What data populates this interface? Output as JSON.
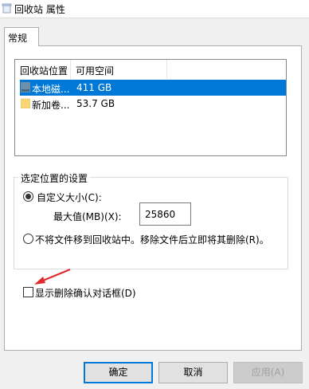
{
  "window": {
    "title": "回收站 属性"
  },
  "tabs": [
    {
      "label": "常规"
    }
  ],
  "listview": {
    "columns": [
      "回收站位置",
      "可用空间"
    ],
    "rows": [
      {
        "name": "本地磁...",
        "space": "411 GB",
        "selected": true,
        "icon": "local-disk-icon"
      },
      {
        "name": "新加卷...",
        "space": "53.7 GB",
        "selected": false,
        "icon": "folder-drive-icon"
      }
    ]
  },
  "settings": {
    "group_title": "选定位置的设置",
    "custom_size_label": "自定义大小(C):",
    "max_value_label": "最大值(MB)(X):",
    "max_value": "25860",
    "no_recycle_label": "不将文件移到回收站中。移除文件后立即将其删除(R)。"
  },
  "confirm_checkbox_label": "显示删除确认对话框(D)",
  "buttons": {
    "ok": "确定",
    "cancel": "取消",
    "apply": "应用(A)"
  },
  "colors": {
    "selection": "#0078d7",
    "annotation_arrow": "#e0282d"
  }
}
